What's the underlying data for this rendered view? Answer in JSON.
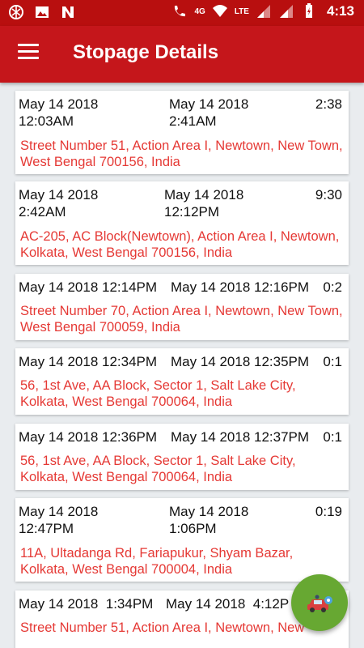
{
  "status_bar": {
    "left_icons": [
      "target-icon",
      "image-icon",
      "n-icon"
    ],
    "network_label": "4G",
    "lte_label": "LTE",
    "time": "4:13"
  },
  "app_bar": {
    "title": "Stopage Details",
    "menu_icon": "hamburger-menu-icon"
  },
  "stopages": [
    {
      "start": "May 14 2018 12:03AM",
      "start_line1": "May 14 2018",
      "start_line2": "12:03AM",
      "end_line1": "May 14 2018",
      "end_line2": "2:41AM",
      "duration": "2:38",
      "address": "Street Number 51, Action Area I, Newtown, New Town, West Bengal 700156, India"
    },
    {
      "start_line1": "May 14 2018",
      "start_line2": "2:42AM",
      "end_line1": "May 14 2018",
      "end_line2": "12:12PM",
      "duration": "9:30",
      "address": "AC-205, AC Block(Newtown), Action Area I, Newtown, Kolkata, West Bengal 700156, India"
    },
    {
      "start_line1": "May 14 2018 12:14PM",
      "end_line1": "May 14 2018 12:16PM",
      "duration": "0:2",
      "address": "Street Number 70, Action Area I, Newtown, New Town, West Bengal 700059, India"
    },
    {
      "start_line1": "May 14 2018 12:34PM",
      "end_line1": "May 14 2018 12:35PM",
      "duration": "0:1",
      "address": "56, 1st Ave, AA Block, Sector 1, Salt Lake City, Kolkata, West Bengal 700064, India"
    },
    {
      "start_line1": "May 14 2018 12:36PM",
      "end_line1": "May 14 2018 12:37PM",
      "duration": "0:1",
      "address": "56, 1st Ave, AA Block, Sector 1, Salt Lake City, Kolkata, West Bengal 700064, India"
    },
    {
      "start_line1": "May 14 2018",
      "start_line2": "12:47PM",
      "end_line1": "May 14 2018",
      "end_line2": "1:06PM",
      "duration": "0:19",
      "address": "11A, Ultadanga Rd, Fariapukur, Shyam Bazar, Kolkata, West Bengal 700004, India"
    },
    {
      "start_line1": "May 14 2018  1:34PM",
      "end_line1": "May 14 2018  4:12P",
      "address": "Street Number 51, Action Area I, Newtown, New"
    }
  ],
  "fab": {
    "icon": "car-icon"
  },
  "colors": {
    "status_bar": "#b80f0f",
    "app_bar": "#c5161b",
    "address_text": "#e53935",
    "fab": "#67a832"
  }
}
